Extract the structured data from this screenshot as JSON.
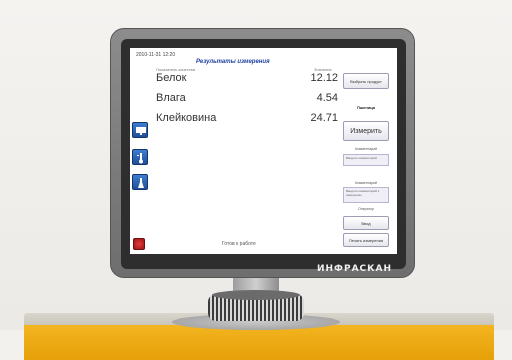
{
  "device": {
    "brand": "ИНФРАСКАН"
  },
  "screen": {
    "datetime": "2010-11-31 12:20",
    "title": "Результаты измерения",
    "columns": {
      "indicator": "Показатель качества",
      "value": "Значение"
    },
    "results": [
      {
        "name": "Белок",
        "value": "12.12"
      },
      {
        "name": "Влага",
        "value": "4.54"
      },
      {
        "name": "Клейковина",
        "value": "24.71"
      }
    ],
    "side_buttons": [
      {
        "icon": "monitor-icon",
        "label": ""
      },
      {
        "icon": "temperature-icon",
        "label": ""
      },
      {
        "icon": "flask-icon",
        "label": ""
      }
    ],
    "right_panel": {
      "select_product": "Выбрать продукт",
      "product_label": "Пшеница",
      "measure": "Измерить",
      "comment_label": "Комментарий",
      "comment_value": "Введите комментарий",
      "comment2_label": "Комментарий",
      "comment2_value": "Введите комментарий к измерению",
      "operator_label": "Оператор",
      "last_button": "Ввод",
      "save_button": "Печать измерения"
    },
    "status": "Готов к работе",
    "stop_icon": "stop-icon"
  },
  "colors": {
    "accent": "#1f4f9a",
    "title": "#1f3fa0",
    "stop": "#c62828",
    "desk": "#f3b521"
  }
}
